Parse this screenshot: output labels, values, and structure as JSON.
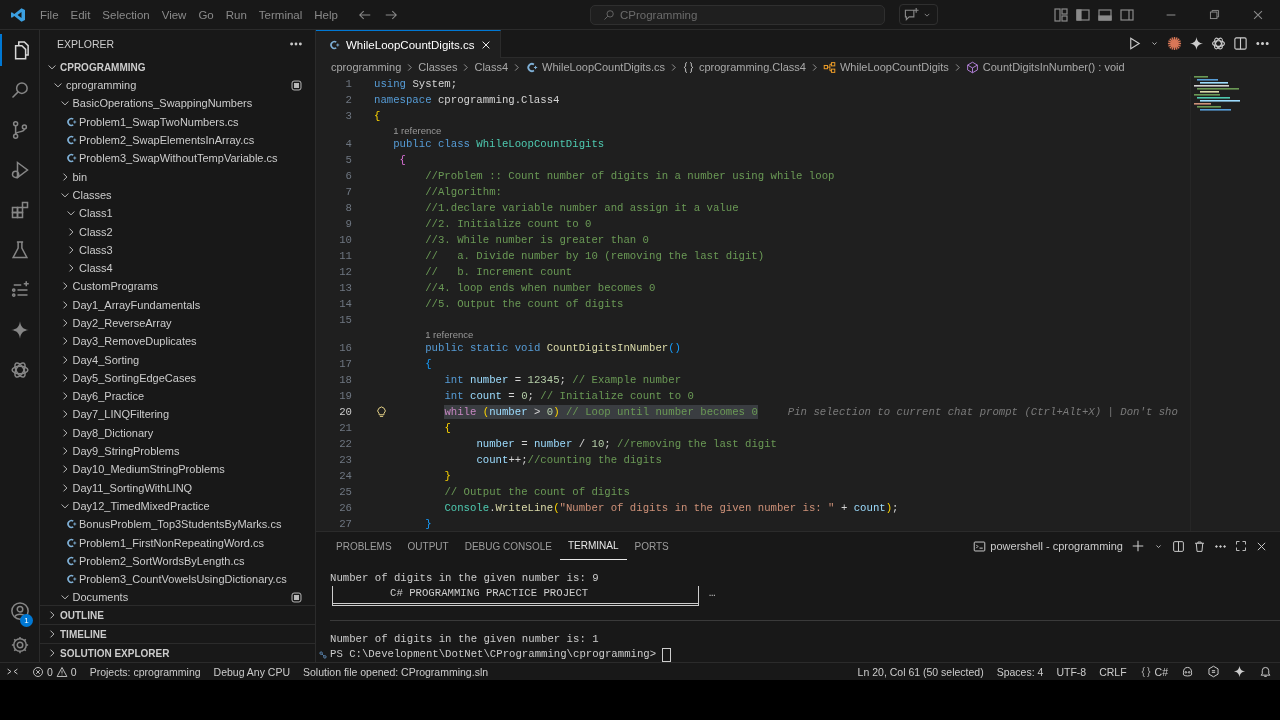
{
  "titlebar": {
    "menus": [
      "File",
      "Edit",
      "Selection",
      "View",
      "Go",
      "Run",
      "Terminal",
      "Help"
    ],
    "command_center": "CProgramming"
  },
  "activity_bar": [
    {
      "kind": "explorer",
      "selected": true
    },
    {
      "kind": "search",
      "selected": false
    },
    {
      "kind": "scm",
      "selected": false
    },
    {
      "kind": "debug",
      "selected": false
    },
    {
      "kind": "extensions",
      "selected": false
    },
    {
      "kind": "testing",
      "selected": false
    },
    {
      "kind": "tasks",
      "selected": false
    },
    {
      "kind": "gemini",
      "selected": false
    },
    {
      "kind": "chatgpt",
      "selected": false
    }
  ],
  "activity_bottom": [
    {
      "kind": "account",
      "badge": "1"
    },
    {
      "kind": "settings"
    }
  ],
  "sidebar": {
    "title": "EXPLORER",
    "sections": [
      {
        "label": "CPROGRAMMING",
        "expanded": true,
        "tree": [
          {
            "label": "cprogramming",
            "kind": "folder",
            "expanded": true,
            "marked": true,
            "children": [
              {
                "label": "BasicOperations_SwappingNumbers",
                "kind": "folder",
                "expanded": true,
                "marked": false,
                "children": [
                  {
                    "label": "Problem1_SwapTwoNumbers.cs",
                    "kind": "file",
                    "marked": false
                  },
                  {
                    "label": "Problem2_SwapElementsInArray.cs",
                    "kind": "file",
                    "marked": false
                  },
                  {
                    "label": "Problem3_SwapWithoutTempVariable.cs",
                    "kind": "file",
                    "marked": false
                  }
                ]
              },
              {
                "label": "bin",
                "kind": "folder",
                "expanded": false,
                "marked": false
              },
              {
                "label": "Classes",
                "kind": "folder",
                "expanded": true,
                "marked": false,
                "children": [
                  {
                    "label": "Class1",
                    "kind": "folder",
                    "expanded": true,
                    "marked": false
                  },
                  {
                    "label": "Class2",
                    "kind": "folder",
                    "expanded": false,
                    "marked": false
                  },
                  {
                    "label": "Class3",
                    "kind": "folder",
                    "expanded": false,
                    "marked": false
                  },
                  {
                    "label": "Class4",
                    "kind": "folder",
                    "expanded": false,
                    "marked": false
                  }
                ]
              },
              {
                "label": "CustomPrograms",
                "kind": "folder",
                "expanded": false,
                "marked": false
              },
              {
                "label": "Day1_ArrayFundamentals",
                "kind": "folder",
                "expanded": false,
                "marked": false
              },
              {
                "label": "Day2_ReverseArray",
                "kind": "folder",
                "expanded": false,
                "marked": false
              },
              {
                "label": "Day3_RemoveDuplicates",
                "kind": "folder",
                "expanded": false,
                "marked": false
              },
              {
                "label": "Day4_Sorting",
                "kind": "folder",
                "expanded": false,
                "marked": false
              },
              {
                "label": "Day5_SortingEdgeCases",
                "kind": "folder",
                "expanded": false,
                "marked": false
              },
              {
                "label": "Day6_Practice",
                "kind": "folder",
                "expanded": false,
                "marked": false
              },
              {
                "label": "Day7_LINQFiltering",
                "kind": "folder",
                "expanded": false,
                "marked": false
              },
              {
                "label": "Day8_Dictionary",
                "kind": "folder",
                "expanded": false,
                "marked": false
              },
              {
                "label": "Day9_StringProblems",
                "kind": "folder",
                "expanded": false,
                "marked": false
              },
              {
                "label": "Day10_MediumStringProblems",
                "kind": "folder",
                "expanded": false,
                "marked": false
              },
              {
                "label": "Day11_SortingWithLINQ",
                "kind": "folder",
                "expanded": false,
                "marked": false
              },
              {
                "label": "Day12_TimedMixedPractice",
                "kind": "folder",
                "expanded": true,
                "marked": false,
                "children": [
                  {
                    "label": "BonusProblem_Top3StudentsByMarks.cs",
                    "kind": "file",
                    "marked": false
                  },
                  {
                    "label": "Problem1_FirstNonRepeatingWord.cs",
                    "kind": "file",
                    "marked": false
                  },
                  {
                    "label": "Problem2_SortWordsByLength.cs",
                    "kind": "file",
                    "marked": false
                  },
                  {
                    "label": "Problem3_CountVowelsUsingDictionary.cs",
                    "kind": "file",
                    "marked": false
                  }
                ]
              },
              {
                "label": "Documents",
                "kind": "folder",
                "expanded": true,
                "marked": true
              }
            ]
          }
        ]
      },
      {
        "label": "OUTLINE",
        "expanded": false
      },
      {
        "label": "TIMELINE",
        "expanded": false
      },
      {
        "label": "SOLUTION EXPLORER",
        "expanded": false
      }
    ]
  },
  "tabs": [
    {
      "label": "WhileLoopCountDigits.cs",
      "selected": true
    }
  ],
  "editor_actions": [
    {
      "kind": "run"
    },
    {
      "kind": "dropdown"
    },
    {
      "kind": "burst"
    },
    {
      "kind": "sparkle"
    },
    {
      "kind": "knot"
    },
    {
      "kind": "split"
    },
    {
      "kind": "more"
    }
  ],
  "breadcrumb": [
    {
      "label": "cprogramming",
      "kind": "folder"
    },
    {
      "label": "Classes",
      "kind": "folder"
    },
    {
      "label": "Class4",
      "kind": "folder"
    },
    {
      "label": "WhileLoopCountDigits.cs",
      "kind": "file"
    },
    {
      "label": "cprogramming.Class4",
      "kind": "namespace"
    },
    {
      "label": "WhileLoopCountDigits",
      "kind": "class"
    },
    {
      "label": "CountDigitsInNumber() : void",
      "kind": "method"
    }
  ],
  "code": [
    {
      "kind": "code",
      "n": "1",
      "selected": false,
      "tokens": [
        {
          "kind": "kw",
          "text": "using "
        },
        {
          "kind": "p",
          "text": "System;"
        }
      ]
    },
    {
      "kind": "code",
      "n": "2",
      "selected": false,
      "tokens": [
        {
          "kind": "kw",
          "text": "namespace "
        },
        {
          "kind": "p",
          "text": "cprogramming.Class4"
        }
      ]
    },
    {
      "kind": "code",
      "n": "3",
      "selected": false,
      "tokens": [
        {
          "kind": "b1",
          "text": "{"
        }
      ]
    },
    {
      "kind": "lens",
      "text": "1 reference"
    },
    {
      "kind": "code",
      "n": "4",
      "selected": false,
      "tokens": [
        {
          "kind": "kw",
          "text": "   public class "
        },
        {
          "kind": "typ",
          "text": "WhileLoopCountDigits"
        }
      ]
    },
    {
      "kind": "code",
      "n": "5",
      "selected": false,
      "tokens": [
        {
          "kind": "b2",
          "text": "    {"
        }
      ]
    },
    {
      "kind": "code",
      "n": "6",
      "selected": false,
      "tokens": [
        {
          "kind": "cm",
          "text": "        //Problem :: Count number of digits in a number using while loop"
        }
      ]
    },
    {
      "kind": "code",
      "n": "7",
      "selected": false,
      "tokens": [
        {
          "kind": "cm",
          "text": "        //Algorithm:"
        }
      ]
    },
    {
      "kind": "code",
      "n": "8",
      "selected": false,
      "tokens": [
        {
          "kind": "cm",
          "text": "        //1.declare variable number and assign it a value"
        }
      ]
    },
    {
      "kind": "code",
      "n": "9",
      "selected": false,
      "tokens": [
        {
          "kind": "cm",
          "text": "        //2. Initialize count to 0"
        }
      ]
    },
    {
      "kind": "code",
      "n": "10",
      "selected": false,
      "tokens": [
        {
          "kind": "cm",
          "text": "        //3. While number is greater than 0"
        }
      ]
    },
    {
      "kind": "code",
      "n": "11",
      "selected": false,
      "tokens": [
        {
          "kind": "cm",
          "text": "        //   a. Divide number by 10 (removing the last digit)"
        }
      ]
    },
    {
      "kind": "code",
      "n": "12",
      "selected": false,
      "tokens": [
        {
          "kind": "cm",
          "text": "        //   b. Increment count"
        }
      ]
    },
    {
      "kind": "code",
      "n": "13",
      "selected": false,
      "tokens": [
        {
          "kind": "cm",
          "text": "        //4. loop ends when number becomes 0"
        }
      ]
    },
    {
      "kind": "code",
      "n": "14",
      "selected": false,
      "tokens": [
        {
          "kind": "cm",
          "text": "        //5. Output the count of digits"
        }
      ]
    },
    {
      "kind": "code",
      "n": "15",
      "selected": false
    },
    {
      "kind": "lens",
      "text": "1 reference"
    },
    {
      "kind": "code",
      "n": "16",
      "selected": false,
      "tokens": [
        {
          "kind": "kw",
          "text": "        public static void "
        },
        {
          "kind": "fn",
          "text": "CountDigitsInNumber"
        },
        {
          "kind": "b3",
          "text": "()"
        }
      ]
    },
    {
      "kind": "code",
      "n": "17",
      "selected": false,
      "tokens": [
        {
          "kind": "b3",
          "text": "        {"
        }
      ]
    },
    {
      "kind": "code",
      "n": "18",
      "selected": false,
      "tokens": [
        {
          "kind": "kw",
          "text": "           int "
        },
        {
          "kind": "id",
          "text": "number"
        },
        {
          "kind": "p",
          "text": " = "
        },
        {
          "kind": "num",
          "text": "12345"
        },
        {
          "kind": "p",
          "text": "; "
        },
        {
          "kind": "cm",
          "text": "// Example number"
        }
      ]
    },
    {
      "kind": "code",
      "n": "19",
      "selected": false,
      "tokens": [
        {
          "kind": "kw",
          "text": "           int "
        },
        {
          "kind": "id",
          "text": "count"
        },
        {
          "kind": "p",
          "text": " = "
        },
        {
          "kind": "num",
          "text": "0"
        },
        {
          "kind": "p",
          "text": "; "
        },
        {
          "kind": "cm",
          "text": "// Initialize count to 0"
        }
      ]
    },
    {
      "kind": "code",
      "n": "20",
      "selected": true,
      "lightbulb": true,
      "hint": "Pin selection to current chat prompt (Ctrl+Alt+X) | Don't sho",
      "tokens": [
        {
          "kind": "ctl",
          "text": "           while "
        },
        {
          "kind": "b1",
          "text": "("
        },
        {
          "kind": "id",
          "text": "number"
        },
        {
          "kind": "p",
          "text": " > "
        },
        {
          "kind": "num",
          "text": "0"
        },
        {
          "kind": "b1",
          "text": ")"
        },
        {
          "kind": "cm",
          "text": " // Loop until number becomes 0"
        }
      ]
    },
    {
      "kind": "code",
      "n": "21",
      "selected": false,
      "tokens": [
        {
          "kind": "b1",
          "text": "           {"
        }
      ]
    },
    {
      "kind": "code",
      "n": "22",
      "selected": false,
      "tokens": [
        {
          "kind": "id",
          "text": "                number"
        },
        {
          "kind": "p",
          "text": " = "
        },
        {
          "kind": "id",
          "text": "number"
        },
        {
          "kind": "p",
          "text": " / "
        },
        {
          "kind": "num",
          "text": "10"
        },
        {
          "kind": "p",
          "text": "; "
        },
        {
          "kind": "cm",
          "text": "//removing the last digit"
        }
      ]
    },
    {
      "kind": "code",
      "n": "23",
      "selected": false,
      "tokens": [
        {
          "kind": "id",
          "text": "                count"
        },
        {
          "kind": "p",
          "text": "++;"
        },
        {
          "kind": "cm",
          "text": "//counting the digits"
        }
      ]
    },
    {
      "kind": "code",
      "n": "24",
      "selected": false,
      "tokens": [
        {
          "kind": "b1",
          "text": "           }"
        }
      ]
    },
    {
      "kind": "code",
      "n": "25",
      "selected": false,
      "tokens": [
        {
          "kind": "cm",
          "text": "           // Output the count of digits"
        }
      ]
    },
    {
      "kind": "code",
      "n": "26",
      "selected": false,
      "tokens": [
        {
          "kind": "typ",
          "text": "           Console"
        },
        {
          "kind": "p",
          "text": "."
        },
        {
          "kind": "fn",
          "text": "WriteLine"
        },
        {
          "kind": "b1",
          "text": "("
        },
        {
          "kind": "str",
          "text": "\"Number of digits in the given number is: \""
        },
        {
          "kind": "p",
          "text": " + "
        },
        {
          "kind": "id",
          "text": "count"
        },
        {
          "kind": "b1",
          "text": ")"
        },
        {
          "kind": "p",
          "text": ";"
        }
      ]
    },
    {
      "kind": "code",
      "n": "27",
      "selected": false,
      "tokens": [
        {
          "kind": "b3",
          "text": "        }"
        }
      ]
    }
  ],
  "panel": {
    "tabs": [
      {
        "label": "PROBLEMS",
        "selected": false
      },
      {
        "label": "OUTPUT",
        "selected": false
      },
      {
        "label": "DEBUG CONSOLE",
        "selected": false
      },
      {
        "label": "TERMINAL",
        "selected": true
      },
      {
        "label": "PORTS",
        "selected": false
      }
    ],
    "terminal_name": "powershell - cprogramming",
    "lines": [
      {
        "kind": "text",
        "text": "Number of digits in the given number is: 9"
      },
      {
        "kind": "box",
        "text": "C# PROGRAMMING PRACTICE PROJECT",
        "more": "…"
      },
      {
        "kind": "divider"
      },
      {
        "kind": "text",
        "text": "Number of digits in the given number is: 1"
      },
      {
        "kind": "prompt",
        "text": "PS C:\\Development\\DotNet\\CProgramming\\cprogramming>"
      }
    ]
  },
  "status_bar": {
    "left": [
      {
        "kind": "remote"
      },
      {
        "kind": "problems",
        "errors": "0",
        "warnings": "0"
      },
      {
        "kind": "text",
        "text": "Projects: cprogramming"
      },
      {
        "kind": "text",
        "text": "Debug Any CPU"
      },
      {
        "kind": "text",
        "text": "Solution file opened: CProgramming.sln"
      }
    ],
    "right": [
      {
        "kind": "text",
        "text": "Ln 20, Col 61 (50 selected)"
      },
      {
        "kind": "text",
        "text": "Spaces: 4"
      },
      {
        "kind": "text",
        "text": "UTF-8"
      },
      {
        "kind": "text",
        "text": "CRLF"
      },
      {
        "kind": "language",
        "text": "C#"
      },
      {
        "kind": "bot"
      },
      {
        "kind": "hexagon"
      },
      {
        "kind": "sparkle"
      },
      {
        "kind": "bell"
      }
    ]
  }
}
